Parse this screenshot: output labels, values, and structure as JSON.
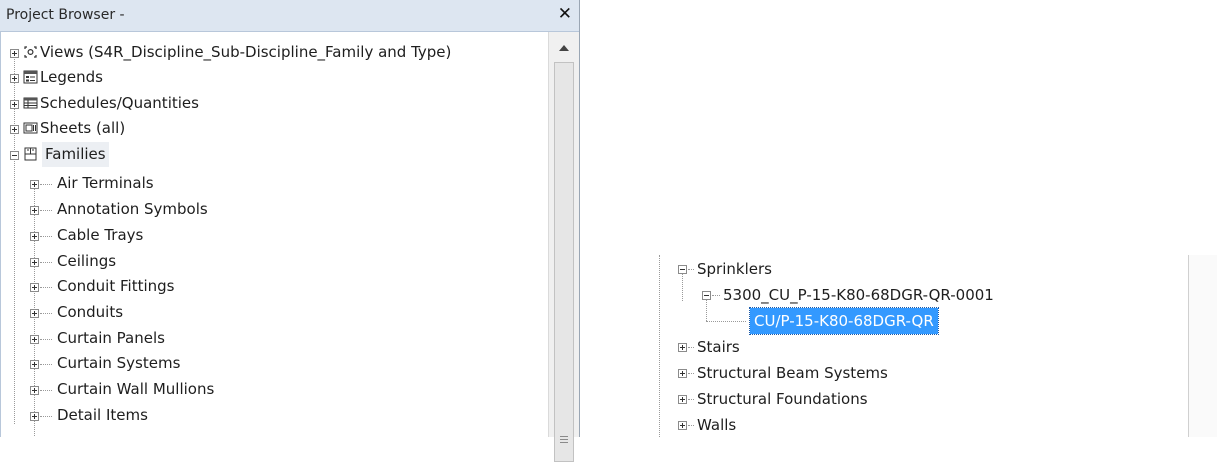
{
  "panel": {
    "title": "Project Browser -",
    "close_glyph": "✕"
  },
  "tree": {
    "top_nodes": [
      {
        "label": "Views (S4R_Discipline_Sub-Discipline_Family and Type)",
        "icon": "views-icon",
        "expanded": false
      },
      {
        "label": "Legends",
        "icon": "legend-icon",
        "expanded": false
      },
      {
        "label": "Schedules/Quantities",
        "icon": "schedule-icon",
        "expanded": false
      },
      {
        "label": "Sheets (all)",
        "icon": "sheet-icon",
        "expanded": false
      },
      {
        "label": "Families",
        "icon": "families-icon",
        "expanded": true
      }
    ],
    "families_children": [
      "Air Terminals",
      "Annotation Symbols",
      "Cable Trays",
      "Ceilings",
      "Conduit Fittings",
      "Conduits",
      "Curtain Panels",
      "Curtain Systems",
      "Curtain Wall Mullions",
      "Detail Items"
    ]
  },
  "detail_tree": {
    "sprinklers": "Sprinklers",
    "family": "5300_CU_P-15-K80-68DGR-QR-0001",
    "type_selected": "CU/P-15-K80-68DGR-QR",
    "siblings": [
      "Stairs",
      "Structural Beam Systems",
      "Structural Foundations",
      "Walls"
    ]
  },
  "colors": {
    "titlebar": "#dde6f1",
    "selection": "#3399ff",
    "families_highlight": "#eceff3"
  }
}
